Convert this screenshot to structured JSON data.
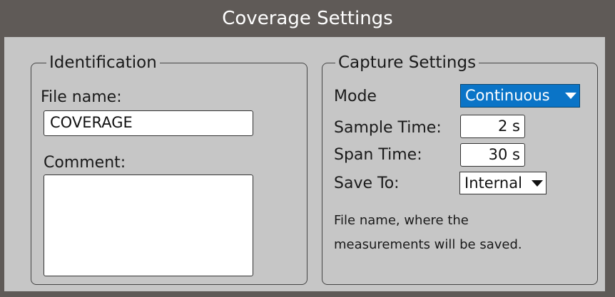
{
  "window": {
    "title": "Coverage Settings"
  },
  "identification": {
    "group_label": "Identification",
    "file_name_label": "File name:",
    "file_name_value": "COVERAGE",
    "comment_label": "Comment:",
    "comment_value": ""
  },
  "capture": {
    "group_label": "Capture Settings",
    "mode_label": "Mode",
    "mode_value": "Continuous",
    "sample_time_label": "Sample Time:",
    "sample_time_value": "2 s",
    "span_time_label": "Span Time:",
    "span_time_value": "30 s",
    "save_to_label": "Save To:",
    "save_to_value": "Internal",
    "hint_line1": "File name, where the",
    "hint_line2": "measurements will be saved."
  },
  "colors": {
    "frame": "#5f5a57",
    "panel": "#c6c6c6",
    "accent": "#0a74c7"
  }
}
